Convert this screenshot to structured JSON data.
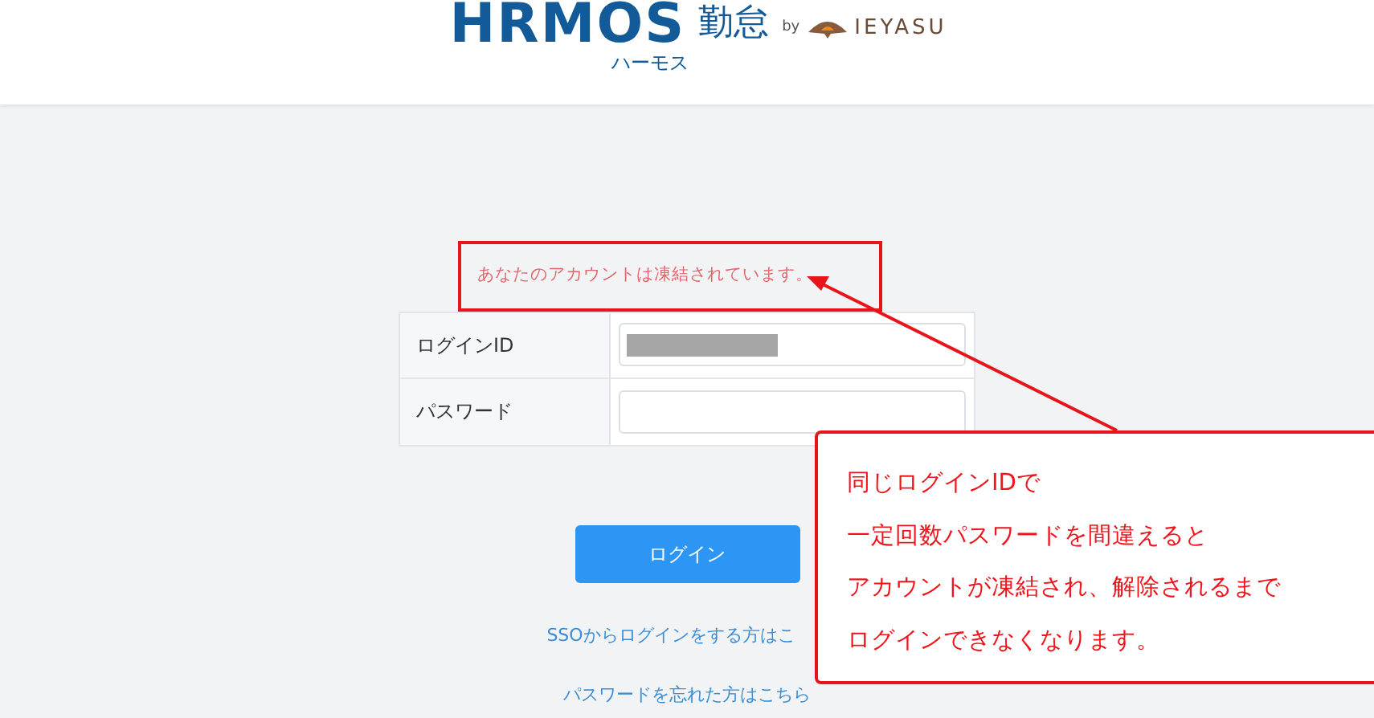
{
  "header": {
    "logo": "HRMOS",
    "product": "勤怠",
    "kana": "ハーモス",
    "by": "by",
    "company": "IEYASU"
  },
  "error_message": "あなたのアカウントは凍結されています。",
  "form": {
    "fields": [
      {
        "label": "ログインID",
        "redacted": true
      },
      {
        "label": "パスワード",
        "redacted": false
      }
    ]
  },
  "login_button": "ログイン",
  "links": [
    "SSOからログインをする方はこ",
    "パスワードを忘れた方はこちら"
  ],
  "callout": {
    "lines": [
      "同じログインIDで",
      "一定回数パスワードを間違えると",
      "アカウントが凍結され、解除されるまで",
      "ログインできなくなります。"
    ]
  }
}
